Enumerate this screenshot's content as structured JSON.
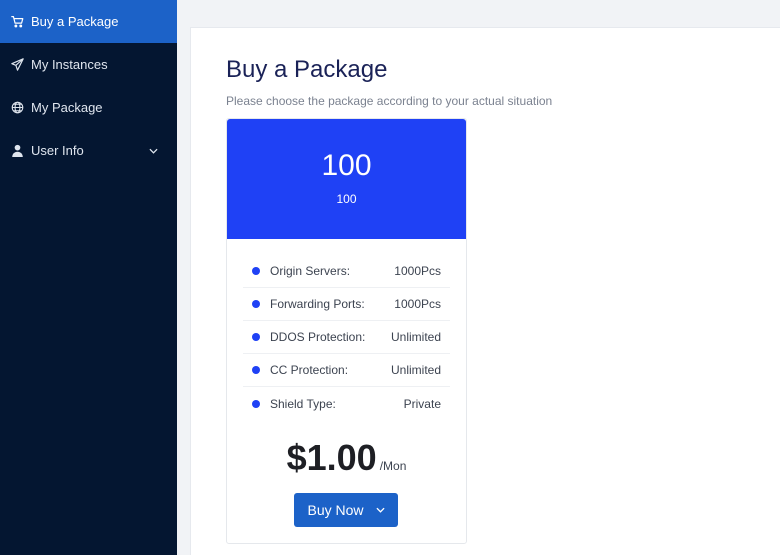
{
  "sidebar": {
    "items": [
      {
        "label": "Buy a Package",
        "icon": "cart-icon",
        "active": true
      },
      {
        "label": "My Instances",
        "icon": "paper-plane-icon",
        "active": false
      },
      {
        "label": "My Package",
        "icon": "globe-icon",
        "active": false
      },
      {
        "label": "User Info",
        "icon": "user-icon",
        "active": false,
        "expandable": true
      }
    ]
  },
  "main": {
    "title": "Buy a Package",
    "subtitle": "Please choose the package according to your actual situation"
  },
  "package": {
    "name": "100",
    "subname": "100",
    "features": [
      {
        "name": "Origin Servers:",
        "value": "1000Pcs"
      },
      {
        "name": "Forwarding Ports:",
        "value": "1000Pcs"
      },
      {
        "name": "DDOS Protection:",
        "value": "Unlimited"
      },
      {
        "name": "CC Protection:",
        "value": "Unlimited"
      },
      {
        "name": "Shield Type:",
        "value": "Private"
      }
    ],
    "price": "$1.00",
    "period": "/Mon",
    "buy_label": "Buy Now"
  },
  "colors": {
    "sidebar_bg": "#041631",
    "active_item": "#1c62c8",
    "card_header": "#1f41f5",
    "button": "#1c62c8",
    "title": "#1a2257"
  }
}
